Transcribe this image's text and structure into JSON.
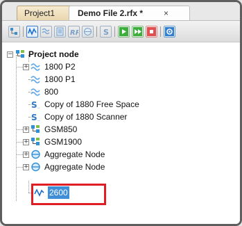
{
  "tabs": [
    {
      "label": "Project1",
      "active": false
    },
    {
      "label": "Demo File 2.rfx *",
      "active": true,
      "close_glyph": "×"
    }
  ],
  "toolbar_icons": [
    "tree-icon",
    "waveform-icon",
    "multi-wave-icon",
    "page-icon",
    "italic-r-icon",
    "disk-icon",
    "s-icon",
    "play-icon",
    "step-forward-icon",
    "stop-icon",
    "gear-icon"
  ],
  "tree": {
    "root": {
      "label": "Project node",
      "expander": "−",
      "icon": "project-node-icon"
    },
    "items": [
      {
        "label": "1800 P2",
        "icon": "wave-icon",
        "expander": "+"
      },
      {
        "label": "1800 P1",
        "icon": "wave-icon",
        "expander": ""
      },
      {
        "label": "800",
        "icon": "wave-icon",
        "expander": ""
      },
      {
        "label": "Copy of 1880 Free Space",
        "icon": "s-icon",
        "expander": ""
      },
      {
        "label": "Copy of 1880 Scanner",
        "icon": "s-icon",
        "expander": ""
      },
      {
        "label": "GSM850",
        "icon": "node-icon",
        "expander": "+"
      },
      {
        "label": "GSM1900",
        "icon": "node-icon",
        "expander": "+"
      },
      {
        "label": "Aggregate Node",
        "icon": "aggregate-icon",
        "expander": "+"
      },
      {
        "label": "Aggregate Node",
        "icon": "aggregate-icon",
        "expander": "+"
      },
      {
        "label": "2600",
        "icon": "signal-icon",
        "expander": "",
        "selected": true
      }
    ]
  },
  "colors": {
    "highlight_box": "#e01c24",
    "selection": "#3f8fd8"
  }
}
